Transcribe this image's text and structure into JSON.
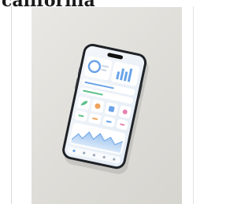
{
  "heading": {
    "text": "california"
  },
  "photo": {
    "background_color": "#e0dfda",
    "phone_frame_color": "#1f2226",
    "screen_color": "#eef3f8",
    "accent_blue": "#6aa3e8",
    "accent_green": "#5cc18a",
    "accent_orange": "#f0a35a",
    "accent_pink": "#e77fb0"
  }
}
